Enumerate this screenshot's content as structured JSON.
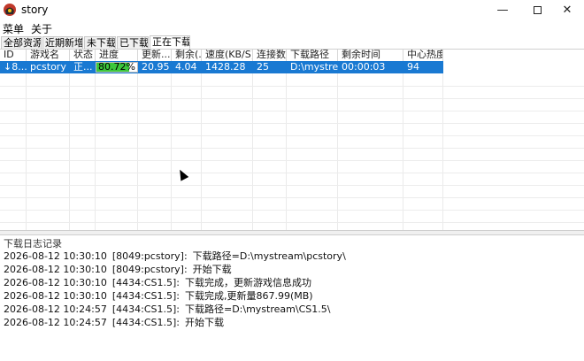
{
  "window": {
    "title": "story",
    "min_glyph": "—",
    "close_glyph": "✕"
  },
  "menu": [
    "菜单",
    "关于"
  ],
  "tabs": [
    "全部资源",
    "近期新增",
    "未下载",
    "已下载",
    "正在下载"
  ],
  "columns": [
    "ID",
    "游戏名",
    "状态",
    "进度",
    "更新...",
    "剩余(...",
    "速度(KB/S)",
    "连接数",
    "下载路径",
    "剩余时间",
    "中心热度"
  ],
  "rows": [
    {
      "arrow": "↓",
      "id": "8...",
      "game": "pcstory",
      "status": "正...",
      "progress_text": "80.72%",
      "progress": 0.8072,
      "update": "20.95",
      "remaining": "4.04",
      "speed": "1428.28",
      "connections": "25",
      "path": "D:\\mystre...",
      "time_left": "00:00:03",
      "heat": "94"
    }
  ],
  "log": {
    "title": "下载日志记录",
    "lines": [
      {
        "time": "2026-08-12 10:30:10",
        "tag": "[8049:pcstory]:",
        "msg": "下载路径=D:\\mystream\\pcstory\\"
      },
      {
        "time": "2026-08-12 10:30:10",
        "tag": "[8049:pcstory]:",
        "msg": "开始下载"
      },
      {
        "time": "2026-08-12 10:30:10",
        "tag": "[4434:CS1.5]:",
        "msg": "下载完成，更新游戏信息成功"
      },
      {
        "time": "2026-08-12 10:30:10",
        "tag": "[4434:CS1.5]:",
        "msg": "下载完成,更新量867.99(MB)"
      },
      {
        "time": "2026-08-12 10:24:57",
        "tag": "[4434:CS1.5]:",
        "msg": "下载路径=D:\\mystream\\CS1.5\\"
      },
      {
        "time": "2026-08-12 10:24:57",
        "tag": "[4434:CS1.5]:",
        "msg": "开始下载"
      }
    ]
  },
  "colors": {
    "selection": "#1979d2",
    "progress_fill": "#3cc83c"
  }
}
